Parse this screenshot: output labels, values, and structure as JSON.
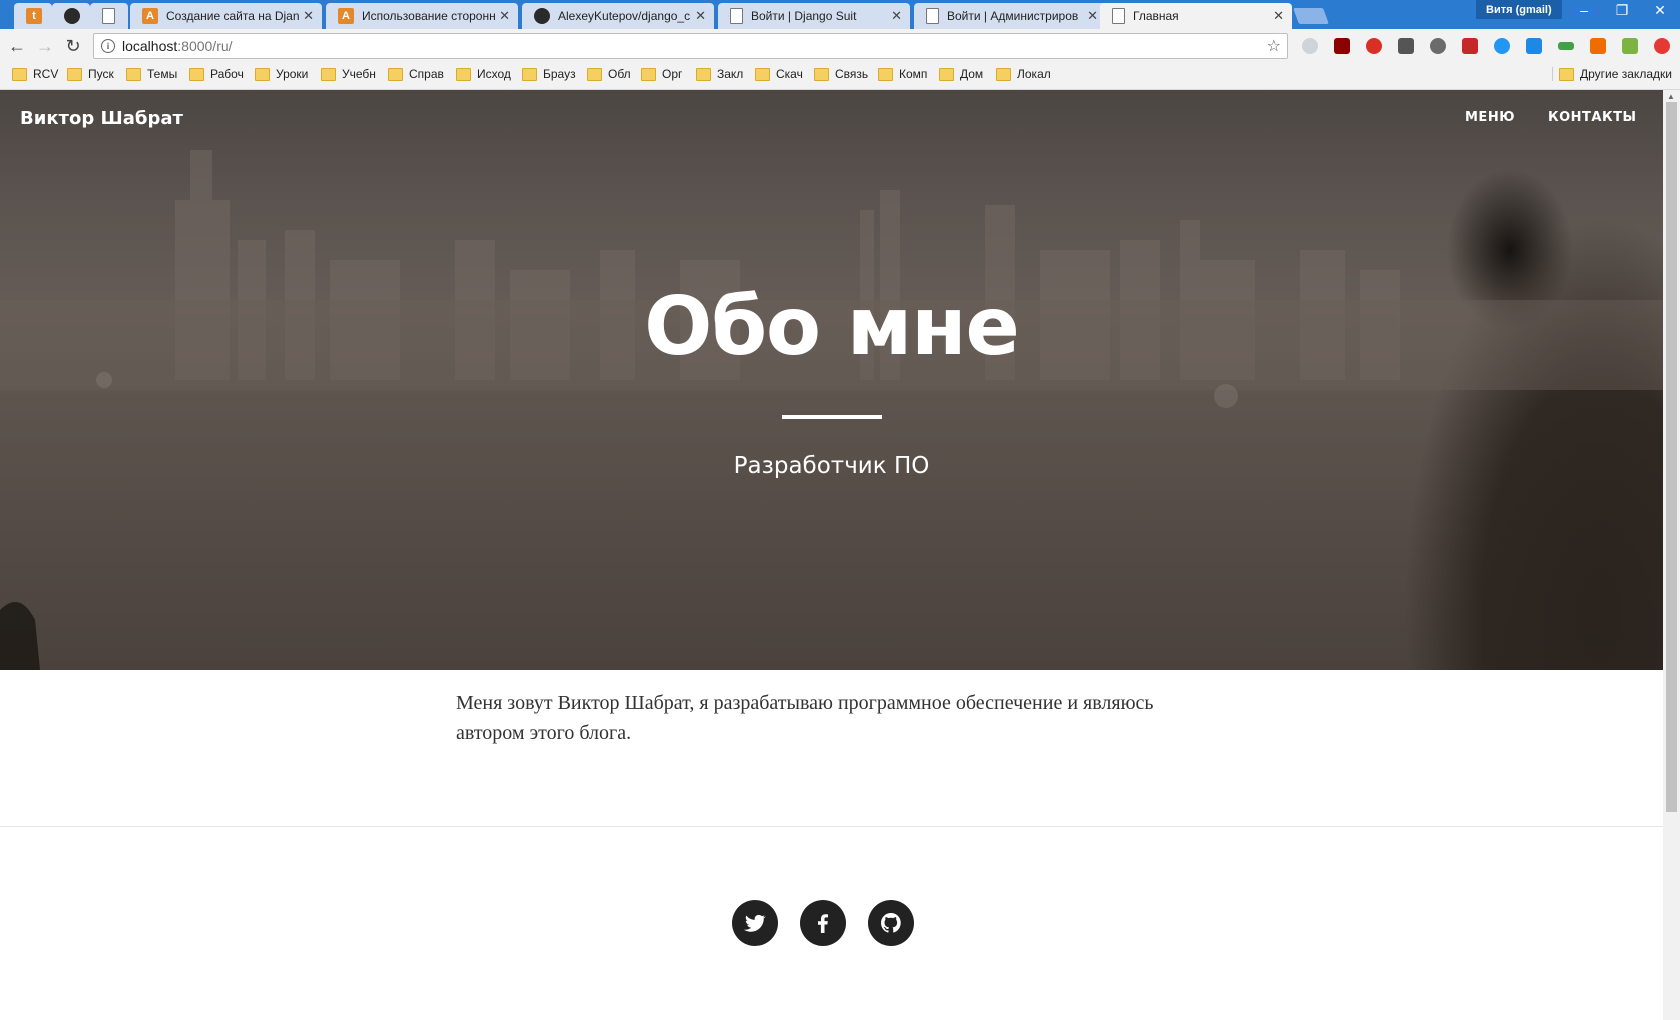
{
  "browser": {
    "tabs": [
      {
        "title": "",
        "favicon": "t-icon"
      },
      {
        "title": "",
        "favicon": "github-icon"
      },
      {
        "title": "",
        "favicon": "document-icon"
      },
      {
        "title": "Создание сайта на Djan",
        "favicon": "a-icon"
      },
      {
        "title": "Использование сторонн",
        "favicon": "a-icon"
      },
      {
        "title": "AlexeyKutepov/django_c",
        "favicon": "github-icon"
      },
      {
        "title": "Войти | Django Suit",
        "favicon": "document-icon"
      },
      {
        "title": "Войти | Администриров",
        "favicon": "document-icon"
      },
      {
        "title": "Главная",
        "favicon": "document-icon",
        "active": true
      }
    ],
    "profile": "Витя (gmail)",
    "address": {
      "host": "localhost",
      "rest": ":8000/ru/"
    },
    "bookmarks": [
      "RCV",
      "Пуск",
      "Темы",
      "Рабоч",
      "Уроки",
      "Учебн",
      "Справ",
      "Исход",
      "Брауз",
      "Обл",
      "Орг",
      "Закл",
      "Скач",
      "Связь",
      "Комп",
      "Дом",
      "Локал"
    ],
    "other_bookmarks": "Другие закладки",
    "accent": "#2b7bd0"
  },
  "site": {
    "brand": "Виктор Шабрат",
    "nav": {
      "menu": "МЕНЮ",
      "contacts": "КОНТАКТЫ"
    },
    "hero": {
      "title": "Обо мне",
      "subtitle": "Разработчик ПО"
    },
    "about_text": "Меня зовут Виктор Шабрат, я разрабатываю программное обеспечение и являюсь автором этого блога.",
    "social": [
      "twitter-icon",
      "facebook-icon",
      "github-icon"
    ]
  }
}
